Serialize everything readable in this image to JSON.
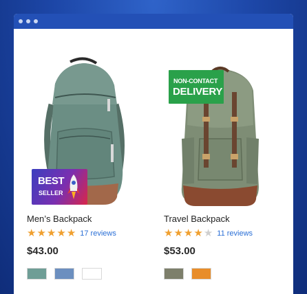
{
  "window": {
    "controls": [
      "dot",
      "dot",
      "dot"
    ]
  },
  "products": [
    {
      "name": "Men’s Backpack",
      "badge": {
        "line1": "BEST",
        "line2": "SELLER",
        "icon": "rocket-icon"
      },
      "rating": 5,
      "rating_max": 5,
      "reviews": "17 reviews",
      "price": "$43.00",
      "swatches": [
        "#6f9e96",
        "#6c8fbf",
        "#ffffff"
      ]
    },
    {
      "name": "Travel Backpack",
      "badge": {
        "line1": "NON-CONTACT",
        "line2": "DELIVERY"
      },
      "rating": 4,
      "rating_max": 5,
      "reviews": "11 reviews",
      "price": "$53.00",
      "swatches": [
        "#7d7f6b",
        "#e88d2a"
      ]
    }
  ],
  "colors": {
    "background": "#1d47a8",
    "titlebar": "#2350b6",
    "star": "#f0a030",
    "link": "#2a6fd6",
    "badge_green": "#2aa14a"
  }
}
